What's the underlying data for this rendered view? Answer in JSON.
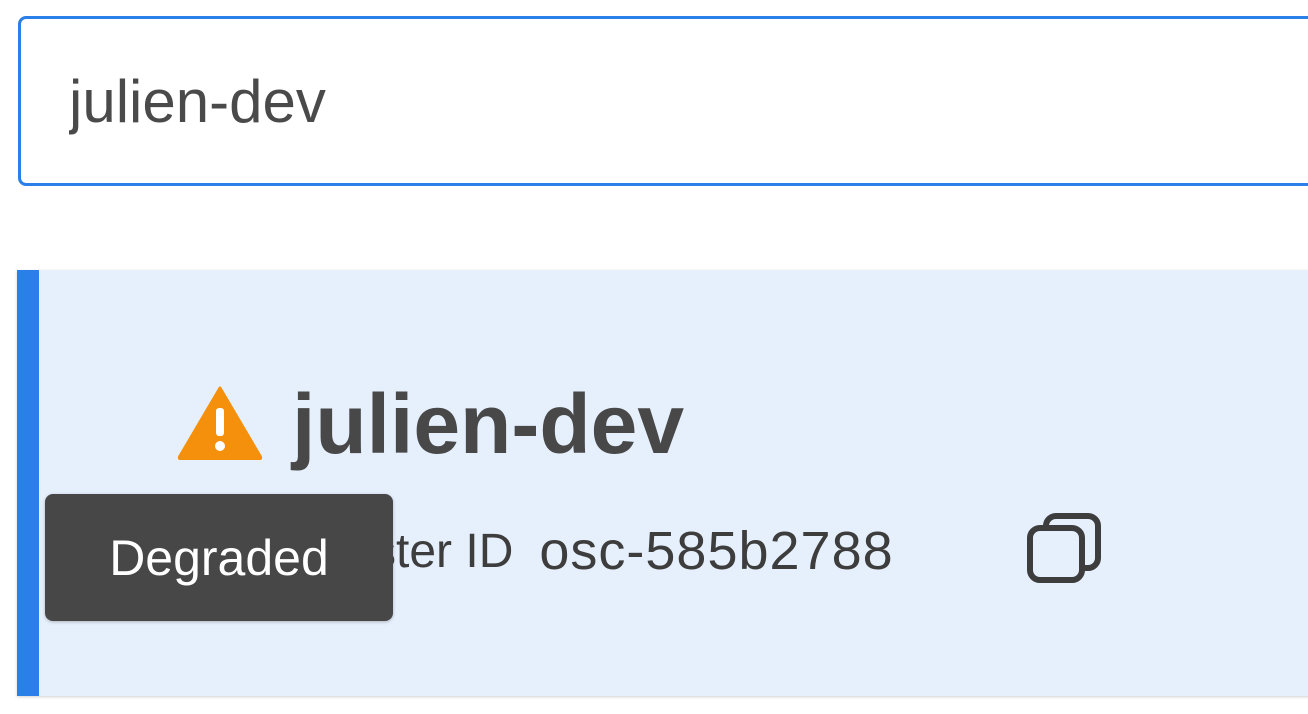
{
  "search": {
    "value": "julien-dev",
    "placeholder": ""
  },
  "cluster": {
    "name": "julien-dev",
    "status_icon": "warning-triangle-icon",
    "status_color": "#f5900c",
    "id_label": "Cluster ID",
    "id_value": "osc-585b2788",
    "copy_icon": "copy-icon"
  },
  "tooltip": {
    "text": "Degraded"
  },
  "colors": {
    "accent": "#2b7fe8",
    "card_background": "#e6f0fc",
    "tooltip_background": "#474747"
  }
}
